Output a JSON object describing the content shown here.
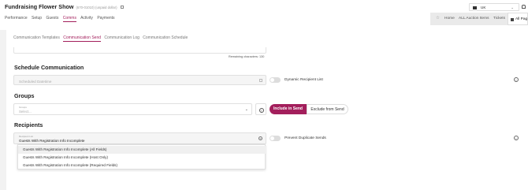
{
  "app": {
    "title": "Fundraising Flower Show",
    "meta": "(670-01010) (unpaid dollar)"
  },
  "region": {
    "label": "UK",
    "chevron": "⌄"
  },
  "main_nav": [
    "Performance",
    "Setup",
    "Guests",
    "Comms",
    "Activity",
    "Payments"
  ],
  "quick_nav": {
    "star": "☆",
    "home": "Home",
    "auction": "ALL Auction Items",
    "tickets": "Tickets",
    "all_pages": "All Pag"
  },
  "sub_tabs": [
    "Communication Templates",
    "Communication Send",
    "Communication Log",
    "Communication Schedule"
  ],
  "message": {
    "chars_remaining": "Remaining characters: 130"
  },
  "schedule": {
    "title": "Schedule Communication",
    "date_placeholder": "Scheduled Datetime",
    "toggle_label": "Dynamic Recipient List"
  },
  "groups": {
    "title": "Groups",
    "field_label": "Groups",
    "placeholder": "Select...",
    "chevron": "⌄",
    "help": "?",
    "include": "Include in Send",
    "exclude": "Exclude from Send"
  },
  "recipients": {
    "title": "Recipients",
    "field_label": "Recipient List",
    "value": "Guests With Registration Info Incomplete",
    "clear": "×",
    "toggle_label": "Prevent Duplicate Sends",
    "options": [
      "Guests With Registration Info Incomplete (All Fields)",
      "Guests With Registration Info Incomplete (Host Only)",
      "Guests With Registration Info Incomplete (Required Fields)"
    ]
  },
  "icons": {
    "info": "i"
  },
  "colors": {
    "accent": "#a31f5c"
  }
}
